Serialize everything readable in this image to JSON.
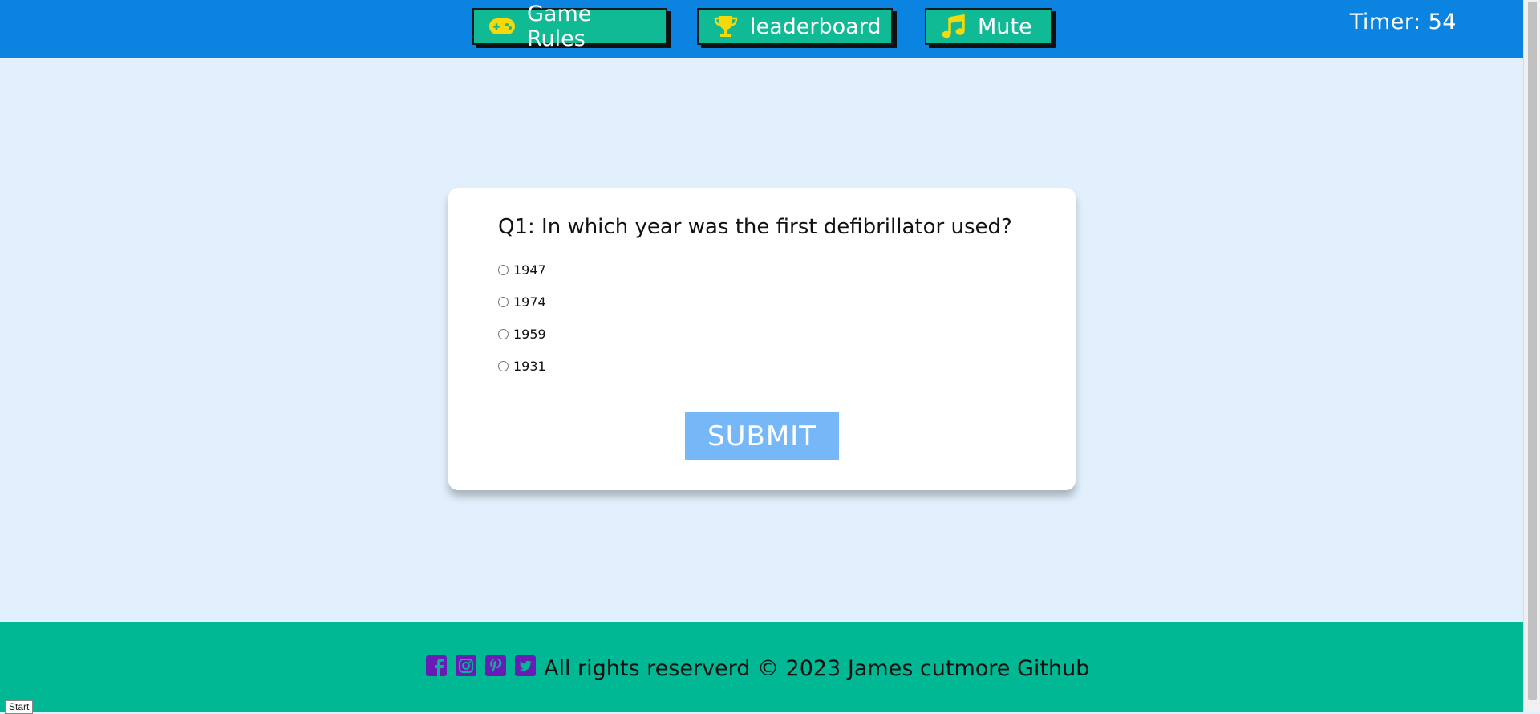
{
  "header": {
    "buttons": [
      {
        "label": "Game Rules",
        "icon": "gamepad-icon"
      },
      {
        "label": "leaderboard",
        "icon": "trophy-icon"
      },
      {
        "label": "Mute",
        "icon": "music-note-icon"
      }
    ],
    "timer": "Timer: 54"
  },
  "quiz": {
    "question": "Q1: In which year was the first defibrillator used?",
    "options": [
      "1947",
      "1974",
      "1959",
      "1931"
    ],
    "submit_label": "SUBMIT"
  },
  "footer": {
    "social_icons": [
      "facebook-icon",
      "instagram-icon",
      "pinterest-icon",
      "twitter-icon"
    ],
    "text": "All rights reserverd © 2023 James cutmore Github"
  },
  "tooltip": "Start",
  "colors": {
    "header_bg": "#0a84e0",
    "nav_button": "#0fba94",
    "page_bg": "#e1f0fc",
    "submit_bg": "#76b8f7",
    "footer_bg": "#00b894",
    "icon_yellow": "#f5d90a",
    "social_purple": "#6a1bb5"
  }
}
